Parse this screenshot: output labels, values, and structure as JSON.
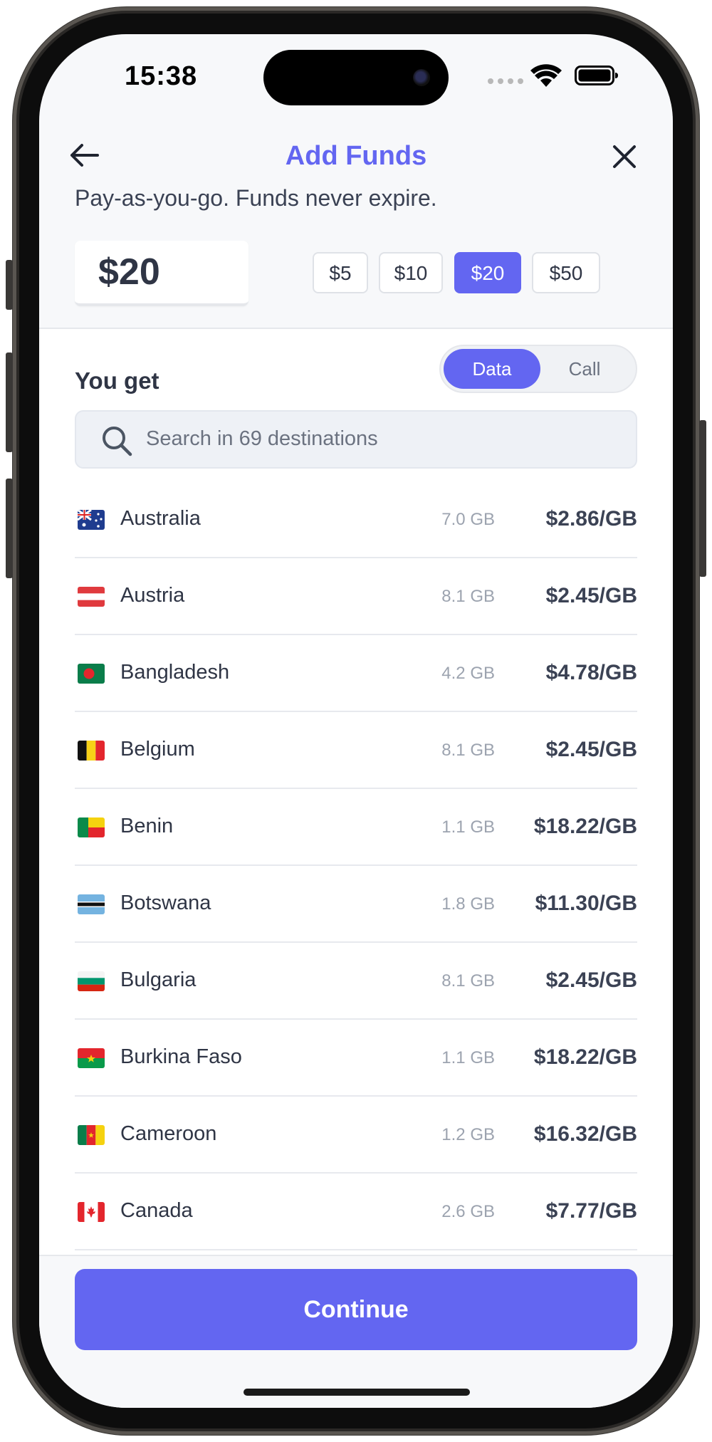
{
  "status_bar": {
    "time": "15:38"
  },
  "header": {
    "title": "Add Funds"
  },
  "tagline": "Pay-as-you-go. Funds never expire.",
  "amount": {
    "value": "$20"
  },
  "presets": [
    {
      "label": "$5",
      "selected": false
    },
    {
      "label": "$10",
      "selected": false
    },
    {
      "label": "$20",
      "selected": true
    },
    {
      "label": "$50",
      "selected": false
    }
  ],
  "you_get": {
    "label": "You get",
    "toggle": {
      "data_label": "Data",
      "call_label": "Call",
      "selected": "Data"
    }
  },
  "search": {
    "placeholder": "Search in 69 destinations"
  },
  "destinations": [
    {
      "country": "Australia",
      "data": "7.0 GB",
      "price": "$2.86/GB",
      "flag_icon": "australia-flag"
    },
    {
      "country": "Austria",
      "data": "8.1 GB",
      "price": "$2.45/GB",
      "flag_icon": "austria-flag"
    },
    {
      "country": "Bangladesh",
      "data": "4.2 GB",
      "price": "$4.78/GB",
      "flag_icon": "bangladesh-flag"
    },
    {
      "country": "Belgium",
      "data": "8.1 GB",
      "price": "$2.45/GB",
      "flag_icon": "belgium-flag"
    },
    {
      "country": "Benin",
      "data": "1.1 GB",
      "price": "$18.22/GB",
      "flag_icon": "benin-flag"
    },
    {
      "country": "Botswana",
      "data": "1.8 GB",
      "price": "$11.30/GB",
      "flag_icon": "botswana-flag"
    },
    {
      "country": "Bulgaria",
      "data": "8.1 GB",
      "price": "$2.45/GB",
      "flag_icon": "bulgaria-flag"
    },
    {
      "country": "Burkina Faso",
      "data": "1.1 GB",
      "price": "$18.22/GB",
      "flag_icon": "burkina-faso-flag"
    },
    {
      "country": "Cameroon",
      "data": "1.2 GB",
      "price": "$16.32/GB",
      "flag_icon": "cameroon-flag"
    },
    {
      "country": "Canada",
      "data": "2.6 GB",
      "price": "$7.77/GB",
      "flag_icon": "canada-flag"
    }
  ],
  "footer": {
    "continue_label": "Continue"
  },
  "colors": {
    "accent": "#6366f1",
    "text": "#2f3545",
    "muted": "#9ca3af"
  }
}
